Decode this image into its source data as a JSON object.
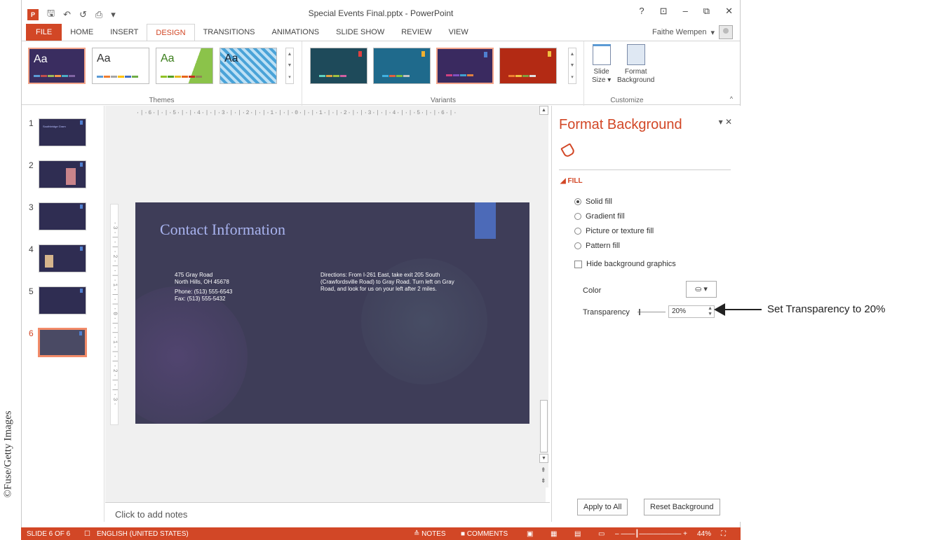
{
  "credit": "©Fuse/Getty Images",
  "window": {
    "title": "Special Events Final.pptx - PowerPoint",
    "controls": [
      "?",
      "⊡",
      "–",
      "⧉",
      "✕"
    ],
    "user": "Faithe Wempen"
  },
  "qat": [
    "↶",
    "↺",
    "⎙",
    "▾"
  ],
  "tabs": [
    "FILE",
    "HOME",
    "INSERT",
    "DESIGN",
    "TRANSITIONS",
    "ANIMATIONS",
    "SLIDE SHOW",
    "REVIEW",
    "VIEW"
  ],
  "ribbon": {
    "themes_label": "Themes",
    "variants_label": "Variants",
    "customize_label": "Customize",
    "theme_aa": "Aa",
    "slide_size": "Slide\nSize ▾",
    "slide_size_l1": "Slide",
    "slide_size_l2": "Size ▾",
    "format_bg_l1": "Format",
    "format_bg_l2": "Background"
  },
  "thumbnails": [
    "1",
    "2",
    "3",
    "4",
    "5",
    "6"
  ],
  "thumb1_title": "Southbridge Gram",
  "ruler": {
    "h": "·|·6·|·|·5·|·|·4·|·|·3·|·|·2·|·|·1·|·|·0·|·|·1·|·|·2·|·|·3·|·|·4·|·|·5·|·|·6·|·",
    "v": "·3·|·|·2·|·|·1·|·|·0·|·|·1·|·|·2·|·|·3·"
  },
  "slide": {
    "title": "Contact Information",
    "addr1": "475 Gray Road",
    "addr2": "North Hills, OH 45678",
    "phone": "Phone: (513) 555-6543",
    "fax": "Fax: (513) 555-5432",
    "directions": "Directions: From I-261 East, take exit 205 South (Crawfordsville Road) to Gray Road. Turn left on Gray Road, and look for us on your left after 2 miles."
  },
  "notes_placeholder": "Click to add notes",
  "pane": {
    "title": "Format Background",
    "fill_header": "FILL",
    "options": [
      "Solid fill",
      "Gradient fill",
      "Picture or texture fill",
      "Pattern fill"
    ],
    "hide_bg": "Hide background graphics",
    "color_label": "Color",
    "transparency_label": "Transparency",
    "transparency_value": "20%",
    "apply_all": "Apply to All",
    "reset": "Reset Background"
  },
  "status": {
    "slide": "SLIDE 6 OF 6",
    "lang": "ENGLISH (UNITED STATES)",
    "notes": "≙ NOTES",
    "comments": "■ COMMENTS",
    "zoom": "44%"
  },
  "callout": "Set Transparency to 20%",
  "colors": {
    "accent": "#d24726",
    "slide_bg": "#3e3d58",
    "slide_title": "#a9b4f0"
  }
}
